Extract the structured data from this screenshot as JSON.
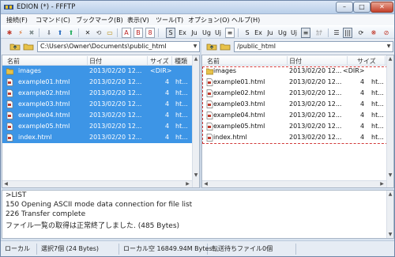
{
  "window": {
    "title": "EDION (*) - FFFTP"
  },
  "menu": [
    "接続(F)",
    "コマンド(C)",
    "ブックマーク(B)",
    "表示(V)",
    "ツール(T)",
    "オプション(O)",
    "ヘルプ(H)"
  ],
  "toolbar": {
    "btn_a": "A",
    "btn_b": "B",
    "btn_8": "8",
    "btn_s": "S",
    "btn_ex": "Ex",
    "btn_ju": "Ju",
    "btn_ug": "Ug",
    "btn_uj": "Uj",
    "btn_s2": "S",
    "btn_ex2": "Ex",
    "btn_ju2": "Ju",
    "btn_ug2": "Ug",
    "btn_uj2": "Uj",
    "btn_kana": "ｶﾅ"
  },
  "local": {
    "path": "C:\\Users\\Owner\\Documents\\public_html",
    "columns": {
      "name": "名前",
      "date": "日付",
      "size": "サイズ",
      "kind": "種類"
    },
    "files": [
      {
        "name": "images",
        "date": "2013/02/20 12...",
        "size": "<DIR>",
        "kind": ""
      },
      {
        "name": "example01.html",
        "date": "2013/02/20 12...",
        "size": "4",
        "kind": "ht..."
      },
      {
        "name": "example02.html",
        "date": "2013/02/20 12...",
        "size": "4",
        "kind": "ht..."
      },
      {
        "name": "example03.html",
        "date": "2013/02/20 12...",
        "size": "4",
        "kind": "ht..."
      },
      {
        "name": "example04.html",
        "date": "2013/02/20 12...",
        "size": "4",
        "kind": "ht..."
      },
      {
        "name": "example05.html",
        "date": "2013/02/20 12...",
        "size": "4",
        "kind": "ht..."
      },
      {
        "name": "index.html",
        "date": "2013/02/20 12...",
        "size": "4",
        "kind": "ht..."
      }
    ]
  },
  "remote": {
    "path": "/public_html",
    "columns": {
      "name": "名前",
      "date": "日付",
      "size": "サイズ",
      "kind": "種"
    },
    "files": [
      {
        "name": "images",
        "date": "2013/02/20 12...",
        "size": "<DIR>",
        "kind": ""
      },
      {
        "name": "example01.html",
        "date": "2013/02/20 12...",
        "size": "4",
        "kind": "ht..."
      },
      {
        "name": "example02.html",
        "date": "2013/02/20 12...",
        "size": "4",
        "kind": "ht..."
      },
      {
        "name": "example03.html",
        "date": "2013/02/20 12...",
        "size": "4",
        "kind": "ht..."
      },
      {
        "name": "example04.html",
        "date": "2013/02/20 12...",
        "size": "4",
        "kind": "ht..."
      },
      {
        "name": "example05.html",
        "date": "2013/02/20 12...",
        "size": "4",
        "kind": "ht..."
      },
      {
        "name": "index.html",
        "date": "2013/02/20 12...",
        "size": "4",
        "kind": "ht..."
      }
    ]
  },
  "log": [
    ">LIST",
    "150 Opening ASCII mode data connection for file list",
    "226 Transfer complete",
    "ファイル一覧の取得は正常終了しました. (485 Bytes)"
  ],
  "status": {
    "location": "ローカル",
    "selected": "選択7個 (24 Bytes)",
    "free": "ローカル空 16849.94M Bytes",
    "queue": "転送待ちファイル0個"
  },
  "colors": {
    "selection": "#3d95e6",
    "drop_outline": "#d23a3a",
    "frame": "#d9e4f1"
  }
}
